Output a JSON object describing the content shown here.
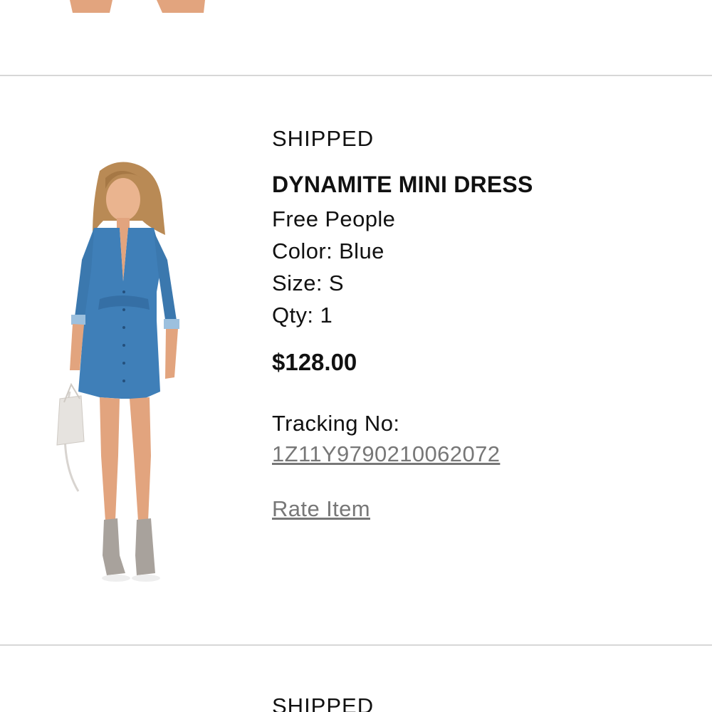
{
  "order_item": {
    "status": "SHIPPED",
    "product_name": "DYNAMITE MINI DRESS",
    "brand": "Free People",
    "color": "Color: Blue",
    "size": "Size: S",
    "quantity": "Qty: 1",
    "price": "$128.00",
    "tracking_label": "Tracking No:",
    "tracking_number": "1Z11Y9790210062072",
    "rate_item_label": "Rate Item"
  },
  "next_item": {
    "status": "SHIPPED"
  },
  "colors": {
    "text": "#111111",
    "link": "#777777",
    "divider": "#d7d7d7",
    "denim": "#3f7fb8",
    "skin": "#e0a07a",
    "boots": "#a8a29c"
  },
  "icons": {
    "product_image": "denim-dress-model-photo"
  }
}
